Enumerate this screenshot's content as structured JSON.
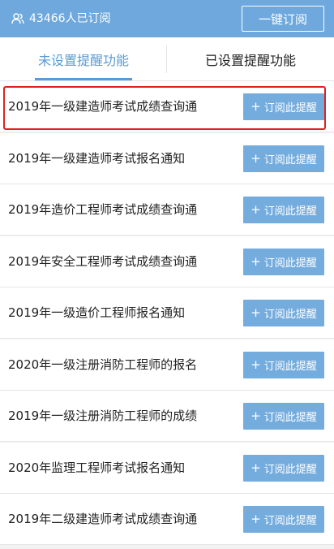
{
  "header": {
    "subscriber_count": "43466人已订阅",
    "one_key_subscribe": "一键订阅"
  },
  "tabs": [
    {
      "label": "未设置提醒功能",
      "active": true
    },
    {
      "label": "已设置提醒功能",
      "active": false
    }
  ],
  "colors": {
    "accent": "#6ea8dc",
    "button": "#74acde",
    "highlight": "#e02020"
  },
  "button_label": "订阅此提醒",
  "items": [
    {
      "title": "2019年一级建造师考试成绩查询通"
    },
    {
      "title": "2019年一级建造师考试报名通知"
    },
    {
      "title": "2019年造价工程师考试成绩查询通"
    },
    {
      "title": "2019年安全工程师考试成绩查询通"
    },
    {
      "title": "2019年一级造价工程师报名通知"
    },
    {
      "title": "2020年一级注册消防工程师的报名"
    },
    {
      "title": "2019年一级注册消防工程师的成绩"
    },
    {
      "title": "2020年监理工程师考试报名通知"
    },
    {
      "title": "2019年二级建造师考试成绩查询通"
    }
  ]
}
